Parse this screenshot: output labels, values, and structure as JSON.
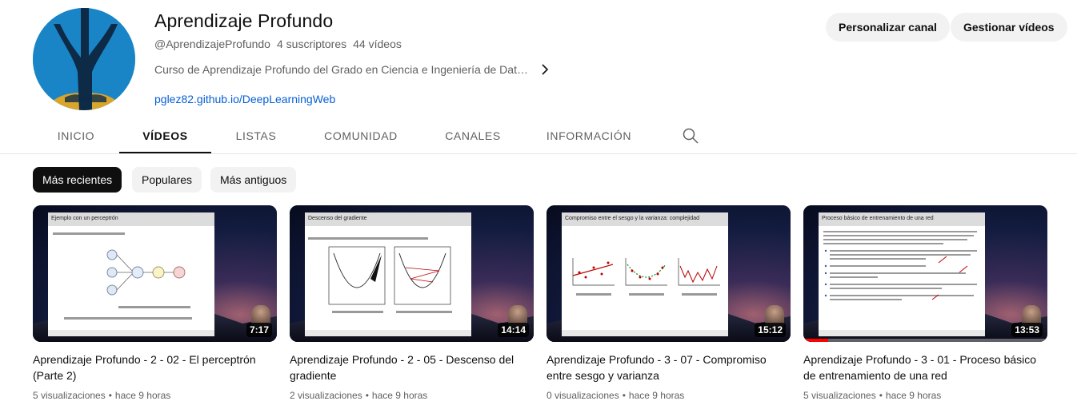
{
  "channel": {
    "title": "Aprendizaje Profundo",
    "handle": "@AprendizajeProfundo",
    "subscribers": "4 suscriptores",
    "videos_count": "44 vídeos",
    "description": "Curso de Aprendizaje Profundo del Grado en Ciencia e Ingeniería de Datos ...",
    "link": "pglez82.github.io/DeepLearningWeb",
    "customize_label": "Personalizar canal",
    "manage_label": "Gestionar vídeos"
  },
  "tabs": [
    {
      "label": "INICIO"
    },
    {
      "label": "VÍDEOS",
      "active": true
    },
    {
      "label": "LISTAS"
    },
    {
      "label": "COMUNIDAD"
    },
    {
      "label": "CANALES"
    },
    {
      "label": "INFORMACIÓN"
    }
  ],
  "chips": [
    {
      "label": "Más recientes",
      "active": true
    },
    {
      "label": "Populares"
    },
    {
      "label": "Más antiguos"
    }
  ],
  "videos": [
    {
      "title": "Aprendizaje Profundo - 2 - 02 - El perceptrón (Parte 2)",
      "views": "5 visualizaciones",
      "time": "hace 9 horas",
      "duration": "7:17",
      "slide_title": "Ejemplo con un perceptrón"
    },
    {
      "title": "Aprendizaje Profundo - 2 - 05 - Descenso del gradiente",
      "views": "2 visualizaciones",
      "time": "hace 9 horas",
      "duration": "14:14",
      "slide_title": "Descenso del gradiente"
    },
    {
      "title": "Aprendizaje Profundo - 3 - 07 - Compromiso entre sesgo y varianza",
      "views": "0 visualizaciones",
      "time": "hace 9 horas",
      "duration": "15:12",
      "slide_title": "Compromiso entre el sesgo y la varianza: complejidad"
    },
    {
      "title": "Aprendizaje Profundo - 3 - 01 - Proceso básico de entrenamiento de una red",
      "views": "5 visualizaciones",
      "time": "hace 9 horas",
      "duration": "13:53",
      "slide_title": "Proceso básico de entrenamiento de una red",
      "watch_progress": 0.1
    }
  ],
  "colors": {
    "link": "#065fd4",
    "avatar_bg": "#1a85c6",
    "progress": "#ff0000"
  }
}
